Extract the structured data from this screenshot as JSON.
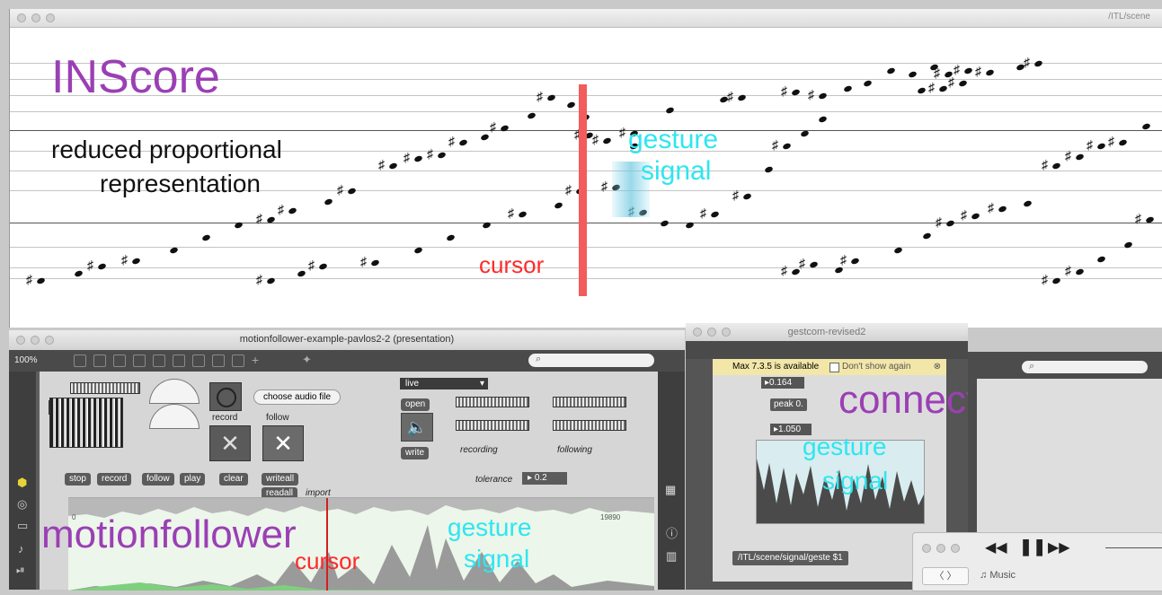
{
  "score_window": {
    "path": "/ITL/scene",
    "title_overlay": "INScore",
    "annotation_reduced": "reduced proportional",
    "annotation_representation": "representation",
    "annotation_gesture": "gesture",
    "annotation_signal": "signal",
    "annotation_cursor": "cursor",
    "colors": {
      "title": "#9b3fb5",
      "gesture": "#2ee6f0",
      "cursor": "#ff2a2a",
      "cursor_bar": "#f25c5c"
    }
  },
  "motionfollower_window": {
    "title": "motionfollower-example-pavlos2-2 (presentation)",
    "zoom": "100%",
    "choose_audio_label": "choose audio file",
    "record_label": "record",
    "follow_label": "follow",
    "mode_select": "live",
    "buttons": {
      "stop": "stop",
      "record": "record",
      "follow": "follow",
      "play": "play",
      "clear": "clear",
      "writeall": "writeall",
      "readall": "readall",
      "open": "open",
      "write": "write"
    },
    "import_label": "import",
    "recording_label": "recording",
    "following_label": "following",
    "tolerance_label": "tolerance",
    "tolerance_value": "0.2",
    "axis_start": "0",
    "axis_end": "19890",
    "overlay_title": "motionfollower",
    "overlay_gesture": "gesture",
    "overlay_signal": "signal",
    "overlay_cursor": "cursor"
  },
  "gestcom_window": {
    "title": "gestcom-revised2",
    "banner_text": "Max 7.3.5 is available",
    "dont_show_label": "Don't show again",
    "value_top": "0.164",
    "peak_label": "peak 0.",
    "value_bottom": "1.050",
    "message_box": "/ITL/scene/signal/geste $1",
    "overlay_connector": "connector",
    "overlay_gesture": "gesture",
    "overlay_signal": "signal"
  },
  "music_player": {
    "library_label": "Music"
  }
}
